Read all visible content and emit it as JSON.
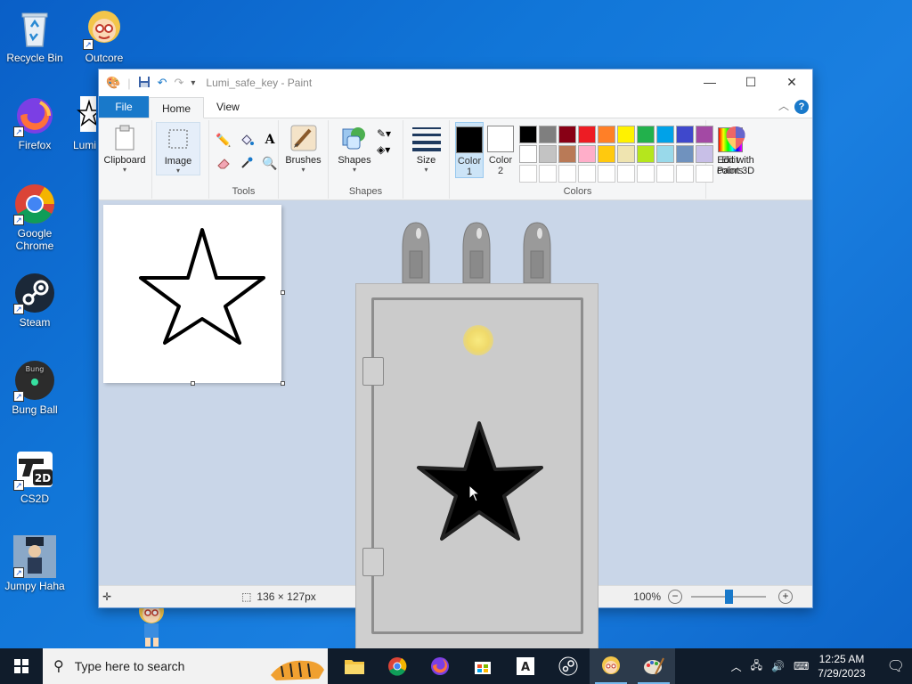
{
  "desktop": {
    "icons": [
      {
        "label": "Recycle Bin"
      },
      {
        "label": "Outcore"
      },
      {
        "label": "Firefox"
      },
      {
        "label": "Lumi"
      },
      {
        "label": "Google Chrome"
      },
      {
        "label": "Steam"
      },
      {
        "label": "Bung Ball"
      },
      {
        "label": "CS2D"
      },
      {
        "label": "Jumpy Haha"
      }
    ]
  },
  "paint": {
    "title": "Lumi_safe_key - Paint",
    "tabs": [
      "File",
      "Home",
      "View"
    ],
    "groups": {
      "clipboard": "Clipboard",
      "image": "Image",
      "tools": "Tools",
      "brushes": "Brushes",
      "shapes_btn": "Shapes",
      "shapes_group": "Shapes",
      "size": "Size",
      "color1": "Color",
      "color1_num": "1",
      "color2": "Color",
      "color2_num": "2",
      "colors_group": "Colors",
      "edit_colors_1": "Edit",
      "edit_colors_2": "colors",
      "edit_3d_1": "Edit with",
      "edit_3d_2": "Paint 3D"
    },
    "palette": [
      "#000000",
      "#7f7f7f",
      "#880015",
      "#ed1c24",
      "#ff7f27",
      "#fff200",
      "#22b14c",
      "#00a2e8",
      "#3f48cc",
      "#a349a4",
      "#ffffff",
      "#c3c3c3",
      "#b97a57",
      "#ffaec9",
      "#ffc90e",
      "#efe4b0",
      "#b5e61d",
      "#99d9ea",
      "#7092be",
      "#c8bfe7",
      "",
      "",
      "",
      "",
      "",
      "",
      "",
      "",
      "",
      ""
    ],
    "color1_value": "#000000",
    "color2_value": "#ffffff",
    "status": {
      "selection_size": "136 × 127px",
      "zoom": "100%"
    }
  },
  "taskbar": {
    "search_placeholder": "Type here to search",
    "time": "12:25 AM",
    "date": "7/29/2023"
  },
  "colors": {
    "accent": "#1979ca",
    "taskbar": "#101c2b",
    "desktop": "#1176d8"
  }
}
